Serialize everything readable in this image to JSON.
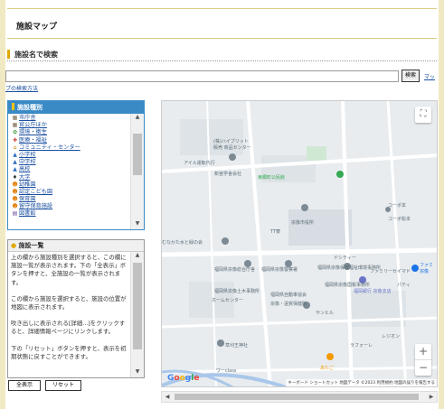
{
  "page": {
    "title": "施設マップ",
    "section_heading": "施設名で検索"
  },
  "search": {
    "value": "",
    "placeholder": "",
    "button_label": "検索",
    "map_link": "マッ",
    "howto_link": "プの検索方法"
  },
  "categories": {
    "heading": "施設種別",
    "items": [
      {
        "label": "市庁舎",
        "icon": "building-icon"
      },
      {
        "label": "官公庁ほか",
        "icon": "building-icon"
      },
      {
        "label": "環境・衛生",
        "icon": "leaf-icon"
      },
      {
        "label": "医療・福祉",
        "icon": "medical-icon"
      },
      {
        "label": "コミュニティ・センター",
        "icon": "community-icon"
      },
      {
        "label": "小学校",
        "icon": "school-icon"
      },
      {
        "label": "中学校",
        "icon": "school-icon"
      },
      {
        "label": "高校",
        "icon": "school-icon"
      },
      {
        "label": "大学",
        "icon": "graduation-icon"
      },
      {
        "label": "幼稚園",
        "icon": "child-icon"
      },
      {
        "label": "認定こども園",
        "icon": "child-icon"
      },
      {
        "label": "保育園",
        "icon": "child-icon"
      },
      {
        "label": "留守保育施設",
        "icon": "child-icon"
      },
      {
        "label": "図書館",
        "icon": "book-icon"
      }
    ]
  },
  "facility_list": {
    "heading": "施設一覧",
    "paragraphs": [
      "上の欄から施設種別を選択すると、この欄に施設一覧が表示されます。下の「全表示」ボタンを押すと、全施設の一覧が表示されます。",
      "この欄から施設を選択すると、施設の位置が地図に表示されます。",
      "吹き出しに表示される[詳細...]をクリックすると、詳細情報ページにリンクします。",
      "下の「リセット」ボタンを押すと、表示を初期状態に戻すことができます。"
    ],
    "show_all_button": "全表示",
    "reset_button": "リセット"
  },
  "map": {
    "labels": {
      "l1": "(株)ハイブリット",
      "l2": "販売 商品センター",
      "l3": "アイル運転代行",
      "l4": "新宮学舎会社",
      "l5": "東郷町公民館",
      "l6": "宗像市役所",
      "l7": "むなかた水と緑の会",
      "l8": "福岡県宗像総合庁舎",
      "l9": "福岡県宗像警察署",
      "l10": "福岡県宗像保健福祉環境事務所",
      "l11": "福岡県宗像国税事務所",
      "l12": "福岡県宗像土木事務所",
      "l13": "福岡県自動車協会",
      "l14": "ホームセンター",
      "l15": "宗像・遠賀保健所",
      "l16": "福岡銀行 宗像支店",
      "l17": "草刈王神社",
      "l18": "ラフォーレ",
      "l19": "レジオン",
      "l20": "あたご",
      "l21": "ワーclass",
      "l22": "コーポ本",
      "l23": "コーポ松本",
      "l24": "ドシティー",
      "l25": "ファミ",
      "l26": "宗像",
      "l27": "ファミリーセイマド",
      "l28": "TT寮",
      "l29": "パティ",
      "l30": "サンヒル"
    },
    "google": [
      "G",
      "o",
      "o",
      "g",
      "l",
      "e"
    ],
    "attribution": "キーボード ショートカット  地図データ ©2023  利用規約  地図の誤りを報告する"
  },
  "colors": {
    "accent": "#3a8ac6",
    "gold": "#e0a800",
    "link": "#1a4fa0"
  }
}
